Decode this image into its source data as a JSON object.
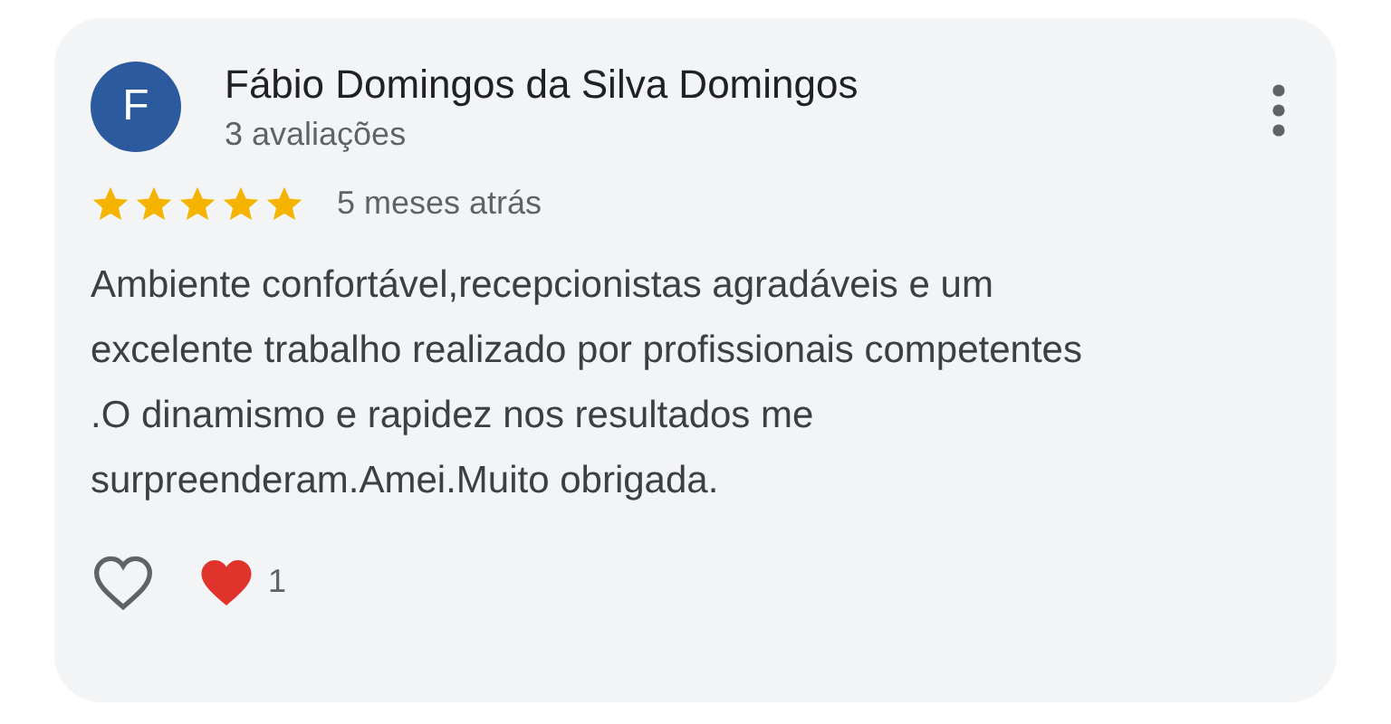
{
  "review": {
    "avatar_letter": "F",
    "author": "Fábio Domingos da Silva Domingos",
    "reviews_count": "3 avaliações",
    "stars": 5,
    "time": "5 meses atrás",
    "text": "Ambiente confortável,recepcionistas agradáveis e um excelente trabalho realizado por profissionais competentes .O dinamismo e rapidez nos resultados me surpreenderam.Amei.Muito obrigada.",
    "liked": false,
    "reaction_count": "1"
  }
}
